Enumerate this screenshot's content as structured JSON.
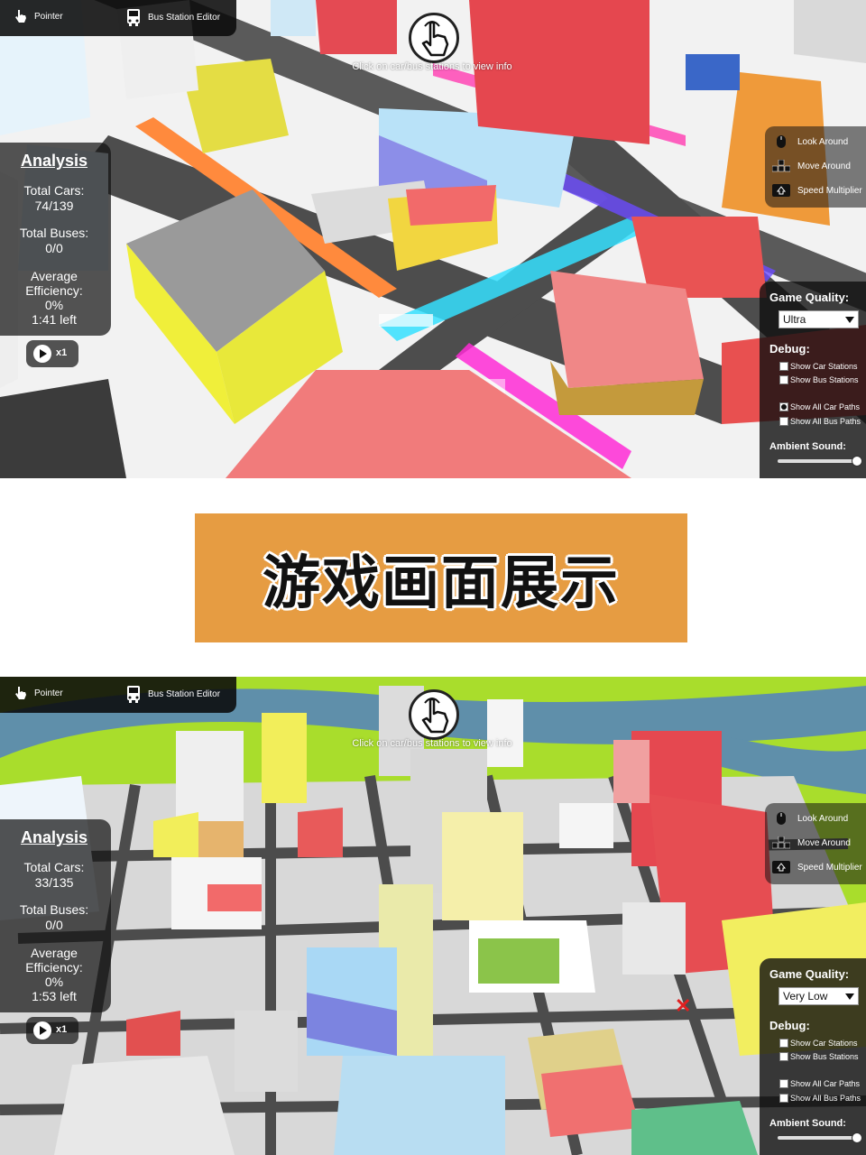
{
  "screens": [
    {
      "toolbar": {
        "pointer_label": "Pointer",
        "bus_editor_label": "Bus Station Editor"
      },
      "hint": "Click on car/bus stations to view info",
      "analysis": {
        "title": "Analysis",
        "cars_label": "Total Cars:",
        "cars_value": "74/139",
        "buses_label": "Total Buses:",
        "buses_value": "0/0",
        "eff_label_1": "Average",
        "eff_label_2": "Efficiency:",
        "eff_value": "0%",
        "time_left": "1:41 left"
      },
      "speed": "x1",
      "controls": {
        "look": "Look Around",
        "move": "Move Around",
        "speed": "Speed Multiplier"
      },
      "settings": {
        "quality_label": "Game Quality:",
        "quality_value": "Ultra",
        "debug_label": "Debug:",
        "show_car_stations": "Show Car Stations",
        "show_bus_stations": "Show Bus Stations",
        "show_car_paths": "Show All Car Paths",
        "show_bus_paths": "Show All Bus Paths",
        "show_car_paths_checked": true,
        "ambient_label": "Ambient Sound:",
        "ambient_level": 0.95
      }
    },
    {
      "toolbar": {
        "pointer_label": "Pointer",
        "bus_editor_label": "Bus Station Editor"
      },
      "hint": "Click on car/bus stations to view info",
      "analysis": {
        "title": "Analysis",
        "cars_label": "Total Cars:",
        "cars_value": "33/135",
        "buses_label": "Total Buses:",
        "buses_value": "0/0",
        "eff_label_1": "Average",
        "eff_label_2": "Efficiency:",
        "eff_value": "0%",
        "time_left": "1:53 left"
      },
      "speed": "x1",
      "controls": {
        "look": "Look Around",
        "move": "Move Around",
        "speed": "Speed Multiplier"
      },
      "settings": {
        "quality_label": "Game Quality:",
        "quality_value": "Very Low",
        "debug_label": "Debug:",
        "show_car_stations": "Show Car Stations",
        "show_bus_stations": "Show Bus Stations",
        "show_car_paths": "Show All Car Paths",
        "show_bus_paths": "Show All Bus Paths",
        "show_car_paths_checked": false,
        "ambient_label": "Ambient Sound:",
        "ambient_level": 0.95
      }
    }
  ],
  "banner": {
    "text": "游戏画面展示",
    "color": "#E69C42"
  }
}
